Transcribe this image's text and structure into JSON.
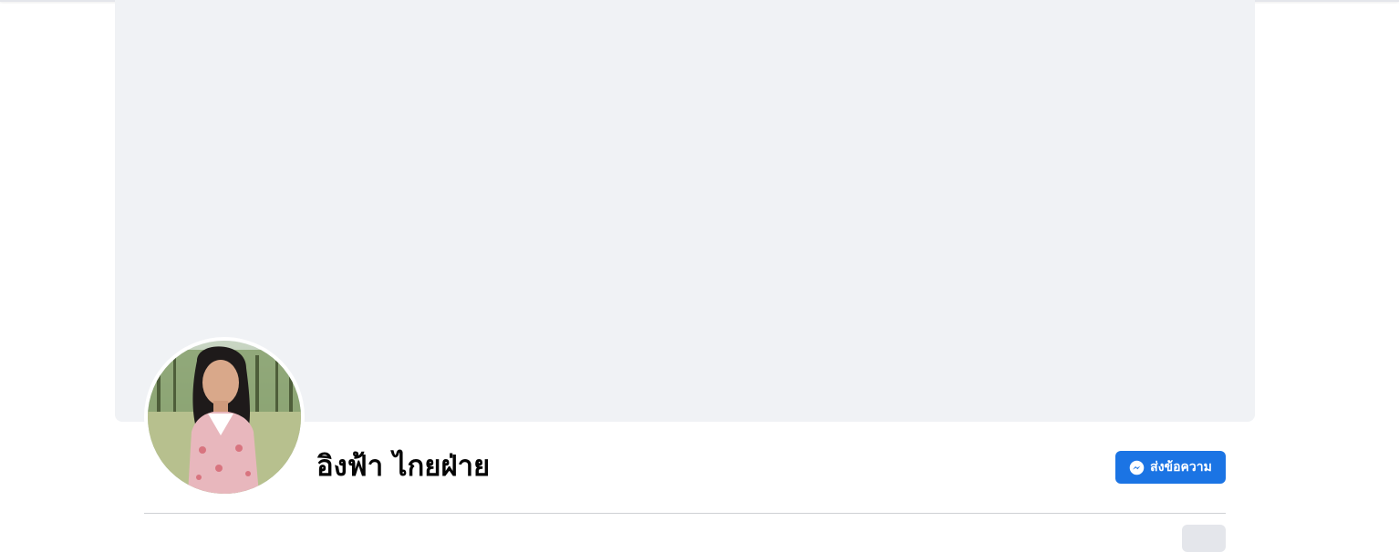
{
  "profile": {
    "name": "อิงฟ้า ไกยฝ่าย",
    "avatar": "profile-photo"
  },
  "actions": {
    "message_label": "ส่งข้อความ",
    "message_icon": "messenger-icon",
    "more_icon": "more-options-icon"
  },
  "colors": {
    "accent": "#1b74e4",
    "cover": "#f0f2f5"
  }
}
